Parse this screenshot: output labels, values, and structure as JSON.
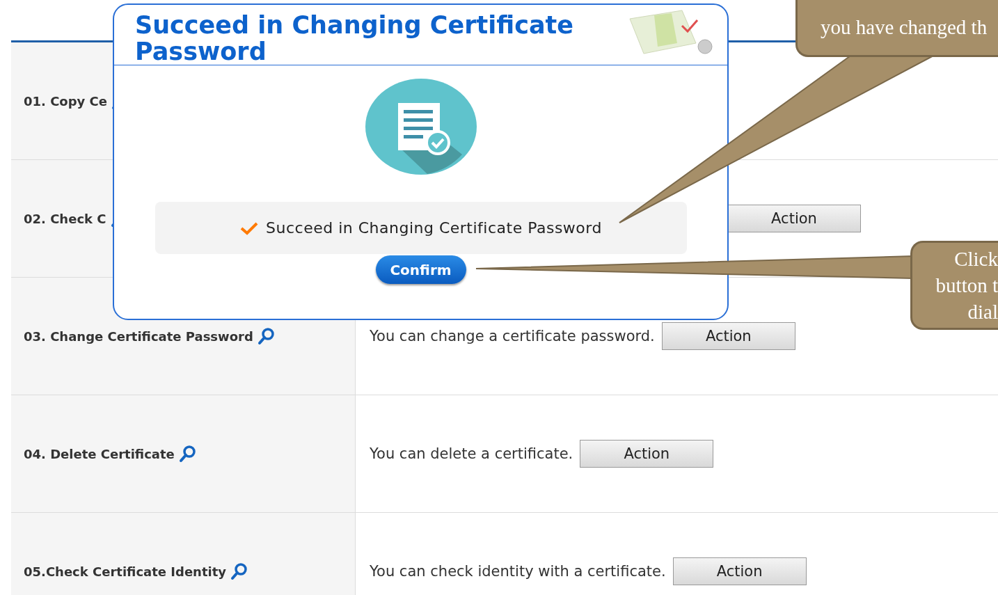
{
  "rows": [
    {
      "title": "01. Copy Ce"
    },
    {
      "title": "02. Check C",
      "button": "Action"
    },
    {
      "title": "03. Change Certificate Password",
      "description": "You can change a certificate password.",
      "button": "Action"
    },
    {
      "title": "04. Delete Certificate",
      "description": "You can delete a certificate.",
      "button": "Action"
    },
    {
      "title": "05.Check Certificate Identity",
      "description": "You can check identity with a certificate.",
      "button": "Action"
    }
  ],
  "dialog": {
    "title": "Succeed in Changing Certificate Password",
    "message": "Succeed in Changing Certificate Password",
    "confirm": "Confirm"
  },
  "callouts": [
    {
      "lines": [
        "you have changed th"
      ]
    },
    {
      "lines": [
        "Click",
        "button t",
        "dial"
      ]
    }
  ]
}
